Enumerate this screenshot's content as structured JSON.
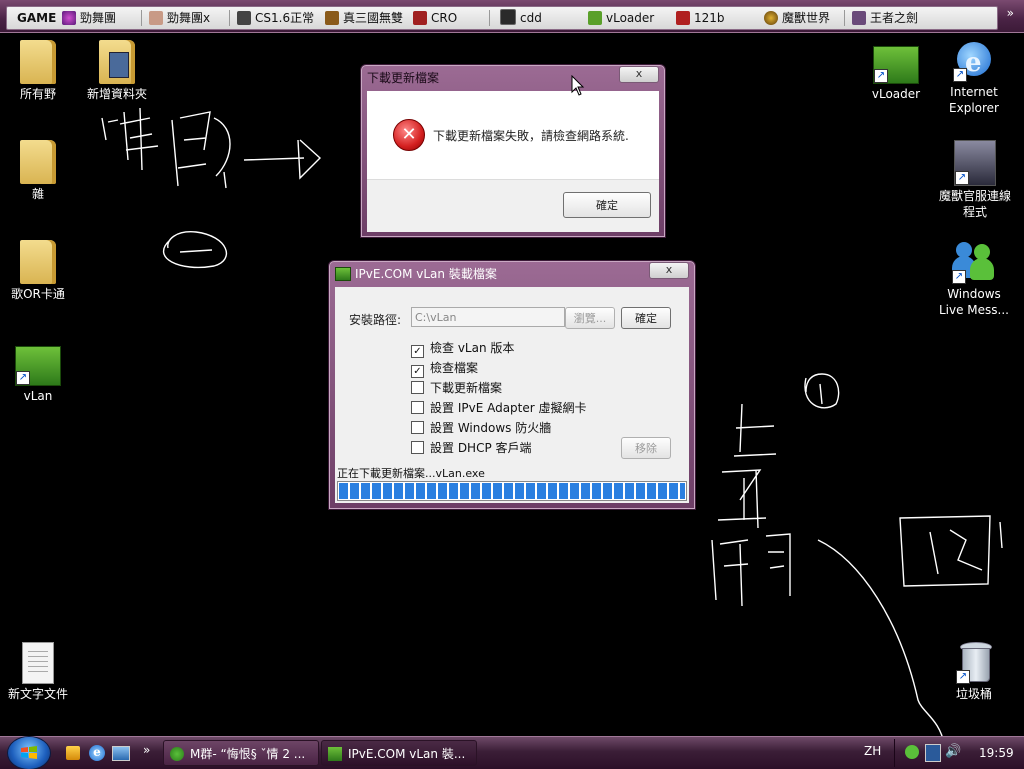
{
  "toolbar": {
    "items": [
      {
        "label": "GAME"
      },
      {
        "label": "勁舞團"
      },
      {
        "label": "勁舞團x"
      },
      {
        "label": "CS1.6正常"
      },
      {
        "label": "真三國無雙"
      },
      {
        "label": "CRO"
      },
      {
        "label": "cdd"
      },
      {
        "label": "vLoader"
      },
      {
        "label": "121b"
      },
      {
        "label": "魔獸世界"
      },
      {
        "label": "王者之劍"
      }
    ],
    "more": "»"
  },
  "desktop_icons": {
    "left": [
      {
        "label": "所有野"
      },
      {
        "label": "新增資料夾"
      },
      {
        "label": "雜"
      },
      {
        "label": "歌OR卡通"
      },
      {
        "label": "vLan"
      },
      {
        "label": "新文字文件"
      }
    ],
    "right": [
      {
        "label": "vLoader"
      },
      {
        "label": "Internet Explorer"
      },
      {
        "label": "魔獸官服連線程式"
      },
      {
        "label": "Windows Live Mess..."
      },
      {
        "label": "垃圾桶"
      }
    ]
  },
  "error_dialog": {
    "title": "下載更新檔案",
    "close": "x",
    "message": "下載更新檔案失敗，請檢查網路系統.",
    "ok_button": "確定"
  },
  "installer_dialog": {
    "title": "IPvE.COM vLan 裝載檔案",
    "close": "x",
    "path_label": "安裝路徑:",
    "path_value": "C:\\vLan",
    "browse_button": "瀏覽...",
    "confirm_button": "確定",
    "checkboxes": [
      {
        "label": "檢查 vLan 版本",
        "checked": true
      },
      {
        "label": "檢查檔案",
        "checked": true
      },
      {
        "label": "下載更新檔案",
        "checked": false
      },
      {
        "label": "設置 IPvE Adapter 虛擬網卡",
        "checked": false
      },
      {
        "label": "設置 Windows 防火牆",
        "checked": false
      },
      {
        "label": "設置 DHCP 客戶端",
        "checked": false
      }
    ],
    "remove_button": "移除",
    "status_text": "正在下載更新檔案...vLan.exe",
    "progress": 1.0
  },
  "taskbar": {
    "more": "»",
    "tasks": [
      {
        "label": "M群- “悔恨§ ˇ情 2 ..."
      },
      {
        "label": "IPvE.COM vLan 裝..."
      }
    ],
    "language": "ZH",
    "clock": "19:59"
  },
  "colors": {
    "accent": "#6d3e66",
    "progress": "#2a7fe0",
    "error_red": "#d42020"
  }
}
